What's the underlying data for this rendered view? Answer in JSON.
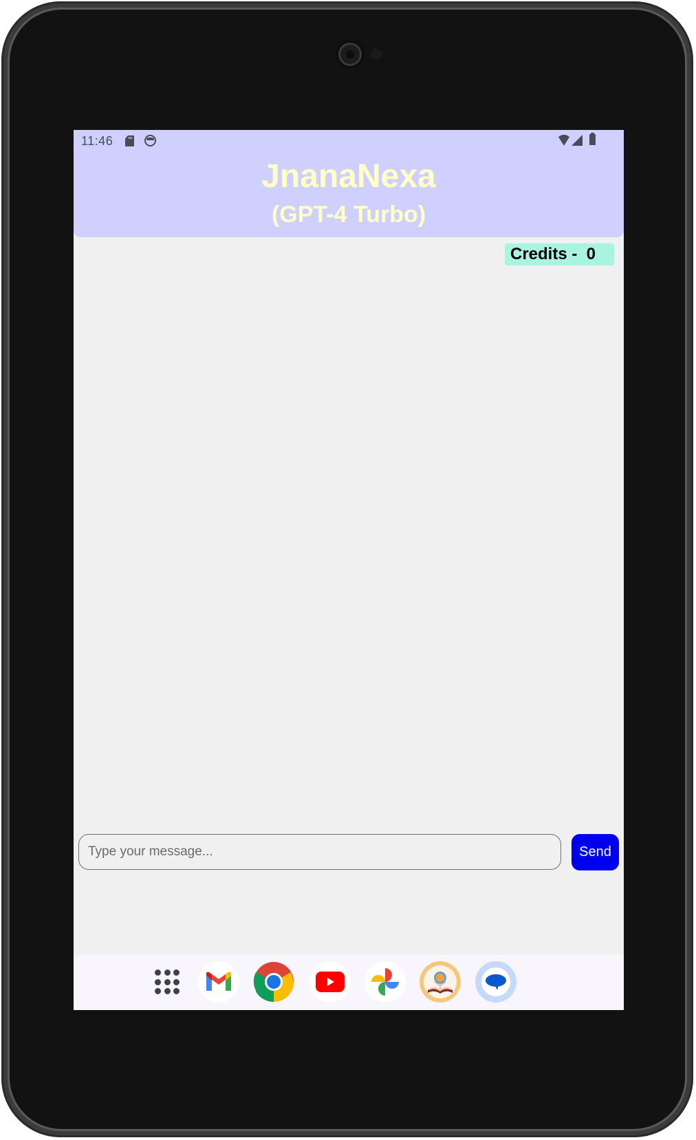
{
  "status_bar": {
    "time": "11:46",
    "icons": [
      "sd-card-icon",
      "vpn-icon",
      "wifi-icon",
      "cell-signal-icon",
      "battery-icon"
    ]
  },
  "header": {
    "title": "JnanaNexa",
    "subtitle": "(GPT-4 Turbo)",
    "background_color": "#d0d0fe",
    "text_color": "#ffffc8"
  },
  "credits": {
    "label": "Credits -  0",
    "value": 0,
    "background_color": "#a8f4e0"
  },
  "chat": {
    "messages": []
  },
  "composer": {
    "input_value": "",
    "input_placeholder": "Type your message...",
    "send_label": "Send",
    "send_color": "#0000f0"
  },
  "dock": {
    "items": [
      {
        "name": "All apps",
        "icon": "apps-grid-icon"
      },
      {
        "name": "Gmail",
        "icon": "gmail-icon"
      },
      {
        "name": "Chrome",
        "icon": "chrome-icon"
      },
      {
        "name": "YouTube",
        "icon": "youtube-icon"
      },
      {
        "name": "Photos",
        "icon": "photos-icon"
      },
      {
        "name": "JnanaNexa",
        "icon": "jnananexa-app-icon"
      },
      {
        "name": "Messages",
        "icon": "messages-icon"
      }
    ]
  }
}
